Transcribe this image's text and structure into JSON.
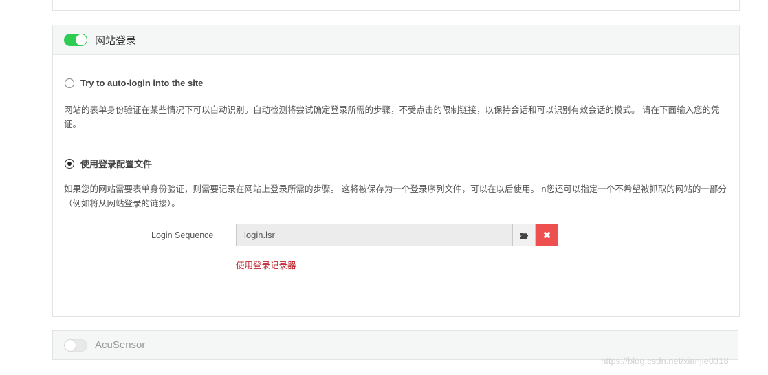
{
  "login_panel": {
    "title": "网站登录",
    "enabled": true,
    "option_auto": {
      "label": "Try to auto-login into the site",
      "selected": false,
      "description": "网站的表单身份验证在某些情况下可以自动识别。自动检测将尝试确定登录所需的步骤，不受点击的限制链接，以保持会话和可以识别有效会话的模式。 请在下面输入您的凭证。"
    },
    "option_profile": {
      "label": "使用登录配置文件",
      "selected": true,
      "description": "如果您的网站需要表单身份验证，则需要记录在网站上登录所需的步骤。 这将被保存为一个登录序列文件，可以在以后使用。 n您还可以指定一个不希望被抓取的网站的一部分（例如将从网站登录的链接）。"
    },
    "login_sequence": {
      "label": "Login Sequence",
      "value": "login.lsr"
    },
    "recorder_link": "使用登录记录器"
  },
  "acusensor_panel": {
    "title": "AcuSensor",
    "enabled": false
  },
  "watermark": "https://blog.csdn.net/xianjie0318",
  "colors": {
    "toggle_on": "#2ecc52",
    "danger": "#ee4f4f",
    "link_red": "#c0202a"
  },
  "icons": {
    "browse": "folder-open-icon",
    "clear": "close-icon"
  }
}
